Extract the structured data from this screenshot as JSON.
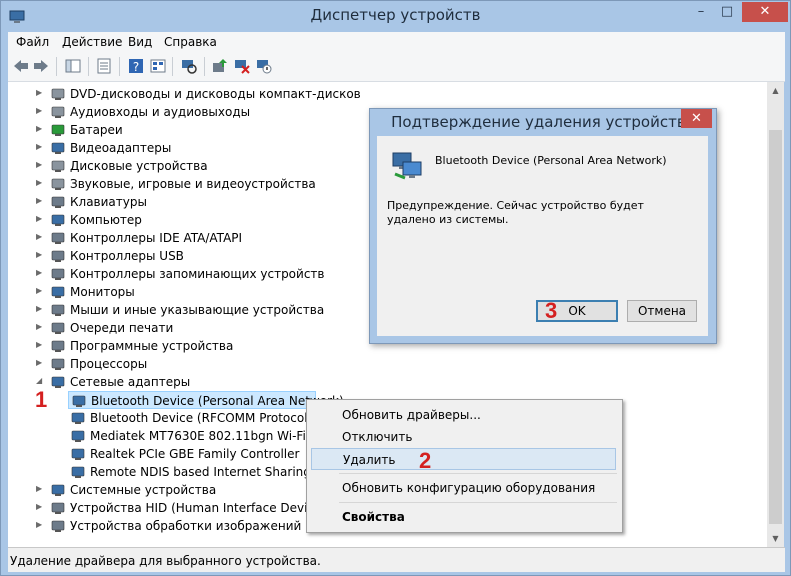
{
  "window": {
    "title": "Диспетчер устройств",
    "minimize": "–",
    "maximize": "□",
    "close": "✕"
  },
  "menu": [
    "Файл",
    "Действие",
    "Вид",
    "Справка"
  ],
  "toolbar": [
    "back-icon",
    "forward-icon",
    "show-hide-console-tree-icon",
    "properties-icon",
    "help-icon",
    "view-icon",
    "scan-hardware-icon",
    "update-driver-icon",
    "uninstall-icon",
    "disable-icon"
  ],
  "tree": {
    "nodes": [
      {
        "label": "DVD-дисководы и дисководы компакт-дисков",
        "icon": "dvd-drive-icon"
      },
      {
        "label": "Аудиовходы и аудиовыходы",
        "icon": "audio-icon"
      },
      {
        "label": "Батареи",
        "icon": "battery-icon"
      },
      {
        "label": "Видеоадаптеры",
        "icon": "display-adapter-icon"
      },
      {
        "label": "Дисковые устройства",
        "icon": "disk-drive-icon"
      },
      {
        "label": "Звуковые, игровые и видеоустройства",
        "icon": "sound-icon"
      },
      {
        "label": "Клавиатуры",
        "icon": "keyboard-icon"
      },
      {
        "label": "Компьютер",
        "icon": "computer-icon"
      },
      {
        "label": "Контроллеры IDE ATA/ATAPI",
        "icon": "ide-controller-icon"
      },
      {
        "label": "Контроллеры USB",
        "icon": "usb-controller-icon"
      },
      {
        "label": "Контроллеры запоминающих устройств",
        "icon": "storage-controller-icon"
      },
      {
        "label": "Мониторы",
        "icon": "monitor-icon"
      },
      {
        "label": "Мыши и иные указывающие устройства",
        "icon": "mouse-icon"
      },
      {
        "label": "Очереди печати",
        "icon": "printer-icon"
      },
      {
        "label": "Программные устройства",
        "icon": "software-device-icon"
      },
      {
        "label": "Процессоры",
        "icon": "processor-icon"
      },
      {
        "label": "Сетевые адаптеры",
        "icon": "network-adapter-icon",
        "expanded": true
      }
    ],
    "network_children": [
      "Bluetooth Device (Personal Area Network)",
      "Bluetooth Device (RFCOMM Protocol TDI",
      "Mediatek MT7630E 802.11bgn Wi-Fi Adap",
      "Realtek PCIe GBE Family Controller",
      "Remote NDIS based Internet Sharing Devi"
    ],
    "nodes_after": [
      {
        "label": "Системные устройства",
        "icon": "system-device-icon"
      },
      {
        "label": "Устройства HID (Human Interface Devices)",
        "icon": "hid-icon"
      },
      {
        "label": "Устройства обработки изображений",
        "icon": "imaging-icon"
      }
    ]
  },
  "context_menu": {
    "items": [
      "Обновить драйверы...",
      "Отключить",
      "Удалить",
      "Обновить конфигурацию оборудования",
      "Свойства"
    ]
  },
  "dialog": {
    "title": "Подтверждение удаления устройства",
    "device": "Bluetooth Device (Personal Area Network)",
    "warning": "Предупреждение. Сейчас устройство будет удалено из системы.",
    "ok": "OK",
    "cancel": "Отмена",
    "close": "✕"
  },
  "annotations": {
    "step1": "1",
    "step2": "2",
    "step3": "3"
  },
  "status": "Удаление драйвера для выбранного устройства.",
  "colors": {
    "window_frame": "#a9c6e6",
    "close_red": "#c7504b",
    "annotation_red": "#d42020",
    "selection": "#cce8ff"
  }
}
